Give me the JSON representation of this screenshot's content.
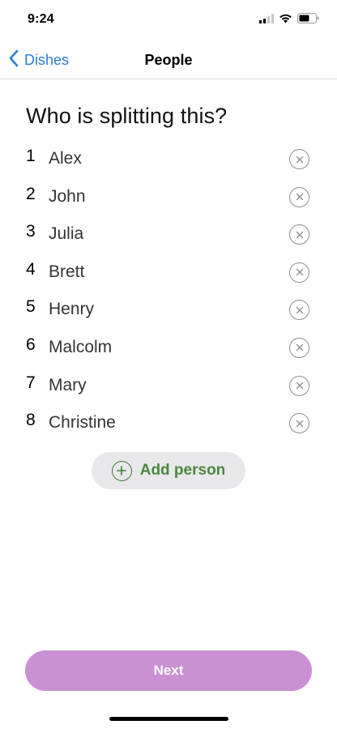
{
  "status_bar": {
    "time": "9:24"
  },
  "nav": {
    "back_label": "Dishes",
    "title": "People"
  },
  "heading": "Who is splitting this?",
  "people": [
    {
      "number": "1",
      "name": "Alex"
    },
    {
      "number": "2",
      "name": "John"
    },
    {
      "number": "3",
      "name": "Julia"
    },
    {
      "number": "4",
      "name": "Brett"
    },
    {
      "number": "5",
      "name": "Henry"
    },
    {
      "number": "6",
      "name": "Malcolm"
    },
    {
      "number": "7",
      "name": "Mary"
    },
    {
      "number": "8",
      "name": "Christine"
    }
  ],
  "add_person_label": "Add person",
  "next_label": "Next",
  "colors": {
    "link_blue": "#2f7bd6",
    "add_green": "#4d8640",
    "next_purple": "#c990d3"
  }
}
